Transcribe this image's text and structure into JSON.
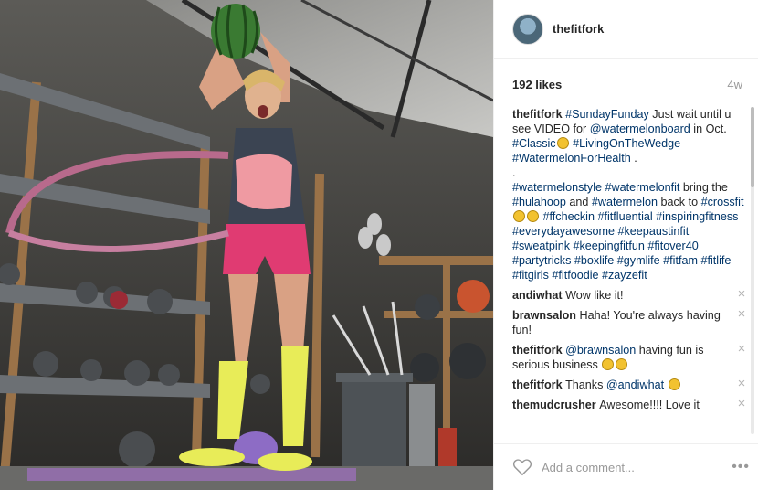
{
  "post": {
    "username": "thefitfork",
    "likes": "192 likes",
    "age": "4w"
  },
  "caption": {
    "username": "thefitfork",
    "lines": [
      [
        {
          "t": "tag",
          "v": "#SundayFunday"
        },
        {
          "t": "text",
          "v": " Just wait until u see VIDEO for "
        },
        {
          "t": "tag",
          "v": "@watermelonboard"
        },
        {
          "t": "text",
          "v": " in Oct. "
        },
        {
          "t": "tag",
          "v": "#Classic"
        },
        {
          "t": "emoji",
          "v": "grinning-face"
        },
        {
          "t": "tag",
          "v": " #LivingOnTheWedge #WatermelonForHealth"
        },
        {
          "t": "text",
          "v": " ."
        }
      ],
      [
        {
          "t": "text",
          "v": "."
        }
      ],
      [
        {
          "t": "tag",
          "v": "#watermelonstyle #watermelonfit"
        },
        {
          "t": "text",
          "v": " bring the "
        },
        {
          "t": "tag",
          "v": "#hulahoop"
        },
        {
          "t": "text",
          "v": " and "
        },
        {
          "t": "tag",
          "v": "#watermelon"
        },
        {
          "t": "text",
          "v": " back to "
        },
        {
          "t": "tag",
          "v": "#crossfit"
        },
        {
          "t": "emoji",
          "v": "grinning-face"
        },
        {
          "t": "emoji",
          "v": "smiling-face"
        },
        {
          "t": "tag",
          "v": " #ffcheckin #fitfluential #inspiringfitness #everydayawesome #keepaustinfit #sweatpink #keepingfitfun #fitover40 #partytricks #boxlife #gymlife #fitfam #fitlife #fitgirls #fitfoodie #zayzefit"
        }
      ]
    ]
  },
  "comments": [
    {
      "user": "andiwhat",
      "parts": [
        {
          "t": "text",
          "v": "Wow like it!"
        }
      ]
    },
    {
      "user": "brawnsalon",
      "parts": [
        {
          "t": "text",
          "v": "Haha! You're always having fun!"
        }
      ]
    },
    {
      "user": "thefitfork",
      "parts": [
        {
          "t": "tag",
          "v": "@brawnsalon"
        },
        {
          "t": "text",
          "v": " having fun is serious business "
        },
        {
          "t": "emoji",
          "v": "grinning-face"
        },
        {
          "t": "emoji",
          "v": "tired-face"
        }
      ]
    },
    {
      "user": "thefitfork",
      "parts": [
        {
          "t": "text",
          "v": "Thanks "
        },
        {
          "t": "tag",
          "v": "@andiwhat"
        },
        {
          "t": "text",
          "v": " "
        },
        {
          "t": "emoji",
          "v": "smiling-face"
        }
      ]
    },
    {
      "user": "themudcrusher",
      "parts": [
        {
          "t": "text",
          "v": "Awesome!!!! Love it"
        }
      ]
    }
  ],
  "icons": {
    "close": "close-icon",
    "heart": "heart-icon",
    "more": "more-options-icon"
  },
  "footer": {
    "placeholder": "Add a comment...",
    "more_glyph": "•••"
  },
  "colors": {
    "link": "#003569",
    "muted": "#999999",
    "text": "#262626"
  }
}
